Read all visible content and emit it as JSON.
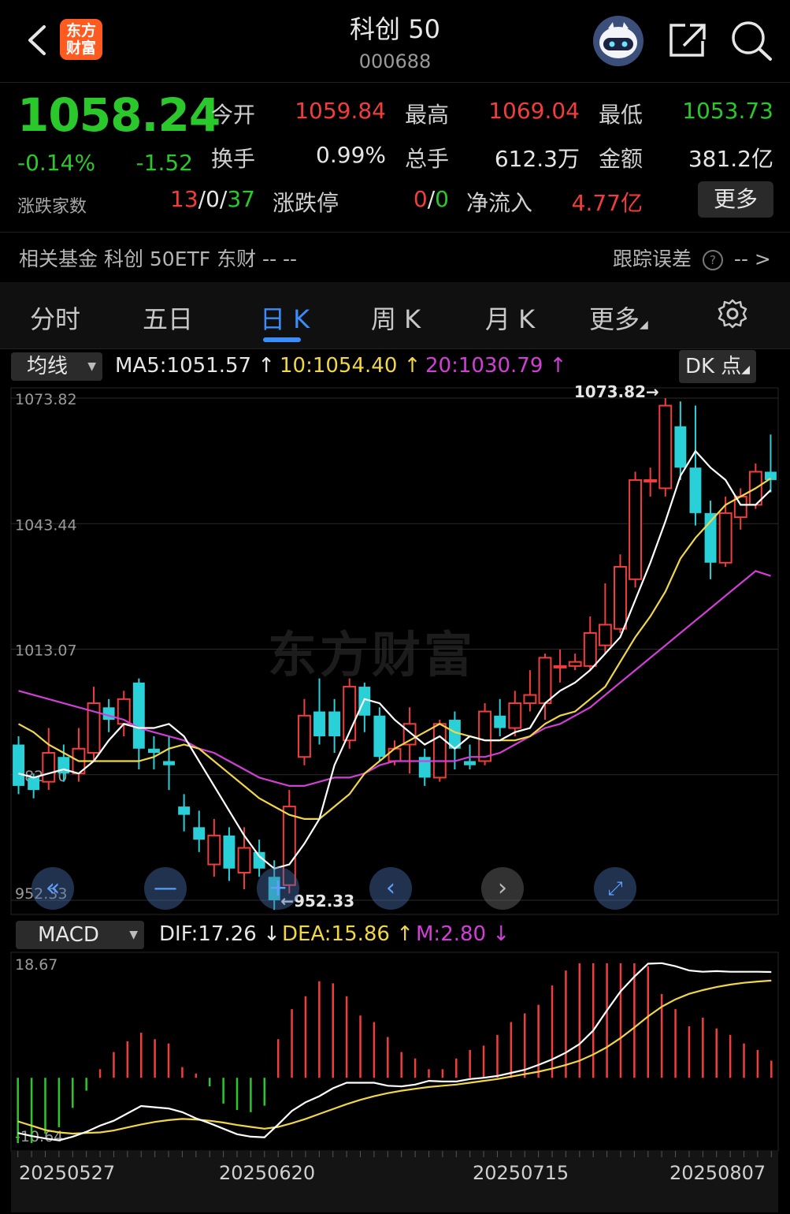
{
  "header": {
    "logo_line1": "东方",
    "logo_line2": "财富",
    "title": "科创 50",
    "code": "000688"
  },
  "quote": {
    "price": "1058.24",
    "change_pct": "-0.14%",
    "change": "-1.52",
    "fields": [
      {
        "label": "今开",
        "value": "1059.84",
        "color": "#f23d3d"
      },
      {
        "label": "最高",
        "value": "1069.04",
        "color": "#f23d3d"
      },
      {
        "label": "最低",
        "value": "1053.73",
        "color": "#2bc82b"
      },
      {
        "label": "换手",
        "value": "0.99%",
        "color": "#e6e6e6"
      },
      {
        "label": "总手",
        "value": "612.3万",
        "color": "#e6e6e6"
      },
      {
        "label": "金额",
        "value": "381.2亿",
        "color": "#e6e6e6"
      }
    ],
    "adv_dec_label": "涨跌家数",
    "adv": "13",
    "flat": "0",
    "dec": "37",
    "limit_label": "涨跌停",
    "limit_up": "0",
    "limit_down": "0",
    "netflow_label": "净流入",
    "netflow": "4.77亿",
    "more_label": "更多"
  },
  "fund_row": {
    "label": "相关基金  科创 50ETF 东财 -- --",
    "tracking_label": "跟踪误差",
    "tracking_value": "-- "
  },
  "tabs": [
    {
      "label": "分时",
      "active": false
    },
    {
      "label": "五日",
      "active": false
    },
    {
      "label": "日 K",
      "active": true
    },
    {
      "label": "周 K",
      "active": false
    },
    {
      "label": "月 K",
      "active": false
    },
    {
      "label": "更多",
      "active": false
    }
  ],
  "ma_row": {
    "select_label": "均线",
    "ma5": "MA5:1051.57 ↑",
    "ma10": "10:1054.40 ↑",
    "ma20": "20:1030.79 ↑",
    "dk_label": "DK 点"
  },
  "watermark": "东方财富",
  "chart_data": [
    {
      "type": "candlestick",
      "y_axis_labels": [
        "1073.82",
        "1043.44",
        "1013.07",
        "982.70",
        "952.33"
      ],
      "ylim": [
        952.33,
        1073.82
      ],
      "high_marker": "1073.82→",
      "low_marker": "←952.33",
      "colors": {
        "up": "#f23d3d",
        "down": "#2ad0d8",
        "ma5": "#ffffff",
        "ma10": "#f0d648",
        "ma20": "#d33ed8"
      },
      "candles": [
        {
          "o": 990,
          "c": 980,
          "h": 992,
          "l": 978
        },
        {
          "o": 982,
          "c": 979,
          "h": 983,
          "l": 977
        },
        {
          "o": 981,
          "c": 988,
          "h": 994,
          "l": 979
        },
        {
          "o": 987,
          "c": 983,
          "h": 990,
          "l": 981
        },
        {
          "o": 983,
          "c": 989,
          "h": 994,
          "l": 981
        },
        {
          "o": 988,
          "c": 1000,
          "h": 1004,
          "l": 986
        },
        {
          "o": 999,
          "c": 996,
          "h": 1001,
          "l": 993
        },
        {
          "o": 995,
          "c": 1001,
          "h": 1003,
          "l": 992
        },
        {
          "o": 1005,
          "c": 989,
          "h": 1006,
          "l": 984
        },
        {
          "o": 989,
          "c": 988,
          "h": 992,
          "l": 984
        },
        {
          "o": 986,
          "c": 985,
          "h": 992,
          "l": 979
        },
        {
          "o": 975,
          "c": 973,
          "h": 978,
          "l": 969
        },
        {
          "o": 970,
          "c": 967,
          "h": 974,
          "l": 964
        },
        {
          "o": 961,
          "c": 968,
          "h": 972,
          "l": 958
        },
        {
          "o": 968,
          "c": 960,
          "h": 970,
          "l": 957
        },
        {
          "o": 959,
          "c": 965,
          "h": 970,
          "l": 955
        },
        {
          "o": 964,
          "c": 960,
          "h": 967,
          "l": 958
        },
        {
          "o": 958,
          "c": 952.33,
          "h": 962,
          "l": 950
        },
        {
          "o": 956,
          "c": 975,
          "h": 979,
          "l": 954
        },
        {
          "o": 987,
          "c": 997,
          "h": 1001,
          "l": 985
        },
        {
          "o": 998,
          "c": 992,
          "h": 1006,
          "l": 990
        },
        {
          "o": 998,
          "c": 992,
          "h": 1001,
          "l": 988
        },
        {
          "o": 991,
          "c": 1004,
          "h": 1006,
          "l": 989
        },
        {
          "o": 1004,
          "c": 997,
          "h": 1005,
          "l": 993
        },
        {
          "o": 997,
          "c": 987,
          "h": 999,
          "l": 986
        },
        {
          "o": 986,
          "c": 989,
          "h": 991,
          "l": 985
        },
        {
          "o": 990,
          "c": 995,
          "h": 999,
          "l": 983
        },
        {
          "o": 987,
          "c": 982,
          "h": 989,
          "l": 980
        },
        {
          "o": 982,
          "c": 995,
          "h": 996,
          "l": 981
        },
        {
          "o": 996,
          "c": 989,
          "h": 998,
          "l": 984
        },
        {
          "o": 986,
          "c": 985,
          "h": 990,
          "l": 984
        },
        {
          "o": 986,
          "c": 998,
          "h": 1000,
          "l": 985
        },
        {
          "o": 997,
          "c": 994,
          "h": 1001,
          "l": 992
        },
        {
          "o": 994,
          "c": 1000,
          "h": 1003,
          "l": 992
        },
        {
          "o": 1000,
          "c": 1002,
          "h": 1008,
          "l": 998
        },
        {
          "o": 1000,
          "c": 1011,
          "h": 1012,
          "l": 996
        },
        {
          "o": 1009,
          "c": 1009,
          "h": 1013,
          "l": 1005
        },
        {
          "o": 1009,
          "c": 1010,
          "h": 1012,
          "l": 1008
        },
        {
          "o": 1009,
          "c": 1017,
          "h": 1021,
          "l": 1008
        },
        {
          "o": 1014,
          "c": 1019,
          "h": 1029,
          "l": 1012
        },
        {
          "o": 1018,
          "c": 1033,
          "h": 1036,
          "l": 1017
        },
        {
          "o": 1030,
          "c": 1054,
          "h": 1056,
          "l": 1028
        },
        {
          "o": 1054,
          "c": 1054,
          "h": 1057,
          "l": 1050
        },
        {
          "o": 1052,
          "c": 1072,
          "h": 1073.82,
          "l": 1050
        },
        {
          "o": 1067,
          "c": 1057,
          "h": 1073,
          "l": 1054
        },
        {
          "o": 1057,
          "c": 1046,
          "h": 1072,
          "l": 1043
        },
        {
          "o": 1046,
          "c": 1034,
          "h": 1049,
          "l": 1030
        },
        {
          "o": 1034,
          "c": 1046,
          "h": 1050,
          "l": 1033
        },
        {
          "o": 1045,
          "c": 1050,
          "h": 1052,
          "l": 1042
        },
        {
          "o": 1048,
          "c": 1056,
          "h": 1058,
          "l": 1047
        },
        {
          "o": 1056,
          "c": 1054,
          "h": 1065,
          "l": 1051
        }
      ],
      "ma5": [
        983,
        982,
        983,
        984,
        983,
        986,
        991,
        995,
        994,
        994,
        995,
        992,
        986,
        980,
        974,
        968,
        963,
        960,
        961,
        966,
        972,
        985,
        993,
        1001,
        1000,
        996,
        993,
        990,
        992,
        989,
        992,
        991,
        991,
        993,
        994,
        1000,
        1003,
        1005,
        1008,
        1012,
        1016,
        1025,
        1034,
        1044,
        1055,
        1061,
        1057,
        1054,
        1048,
        1048,
        1051.57
      ],
      "ma10": [
        995,
        993,
        990,
        988,
        986,
        986,
        986,
        986,
        986,
        987,
        989,
        990,
        989,
        986,
        983,
        980,
        977,
        975,
        973,
        972,
        972,
        975,
        978,
        983,
        986,
        989,
        991,
        993,
        995,
        993,
        992,
        991,
        991,
        991,
        992,
        995,
        997,
        998,
        1001,
        1004,
        1010,
        1016,
        1021,
        1027,
        1035,
        1040,
        1044,
        1048,
        1050,
        1052,
        1054.4
      ],
      "ma20": [
        1003,
        1002,
        1001,
        1000,
        999,
        998,
        997,
        996,
        994,
        993,
        992,
        991,
        989,
        988,
        986,
        984,
        982,
        981,
        980,
        980,
        981,
        982,
        982,
        983,
        985,
        986,
        986,
        986,
        986,
        986,
        987,
        987,
        988,
        990,
        992,
        994,
        995,
        997,
        999,
        1002,
        1005,
        1008,
        1011,
        1014,
        1017,
        1020,
        1023,
        1026,
        1029,
        1032,
        1030.79
      ]
    },
    {
      "type": "bar+line",
      "title": "MACD",
      "dif_label": "DIF:17.26 ↓",
      "dea_label": "DEA:15.86 ↑",
      "m_label": "M:2.80 ↓",
      "y_axis_labels": [
        "18.67",
        "-10.64"
      ],
      "ylim": [
        -10.64,
        18.67
      ],
      "x_labels": [
        "20250527",
        "20250620",
        "20250715",
        "20250807"
      ],
      "colors": {
        "pos": "#f23d3d",
        "neg": "#2bc82b",
        "dif": "#ffffff",
        "dea": "#f0d648"
      },
      "m": [
        -5,
        -4,
        -2.6,
        -2.3,
        -1.4,
        -0.6,
        0.4,
        1.2,
        1.7,
        2.1,
        1.8,
        1.6,
        0.5,
        0.2,
        -0.4,
        -1.2,
        -1.5,
        -1.6,
        -1.3,
        1.8,
        3.2,
        3.8,
        4.5,
        4.4,
        3.8,
        2.9,
        2.6,
        1.9,
        1.2,
        0.9,
        0.4,
        0.4,
        0.9,
        1.3,
        1.5,
        2.0,
        2.6,
        3.0,
        3.4,
        4.3,
        5.0,
        5.6,
        6.3,
        7.2,
        7.8,
        6.9,
        5.2,
        3.9,
        3.2,
        2.4,
        2.8,
        2.3,
        2.0,
        1.6,
        1.3,
        0.8
      ],
      "dif": [
        -9,
        -9.5,
        -9.9,
        -10.2,
        -9.6,
        -8.8,
        -7.8,
        -7,
        -5.8,
        -4.6,
        -4.8,
        -5,
        -5.6,
        -6.6,
        -7.4,
        -8.3,
        -9.2,
        -9.6,
        -9.7,
        -7.6,
        -5.4,
        -4,
        -3,
        -1.7,
        -0.8,
        -0.8,
        -0.8,
        -1.3,
        -1.4,
        -1.1,
        -0.5,
        -0.6,
        -0.6,
        -0.2,
        0,
        0.3,
        0.8,
        1.3,
        2.1,
        3.0,
        4.1,
        5.5,
        7.7,
        11,
        14.1,
        16.5,
        18.6,
        18.7,
        18.2,
        17.5,
        17.3,
        17.4,
        17.3,
        17.3,
        17.3,
        17.26
      ],
      "dea": [
        -7.1,
        -7.8,
        -8.5,
        -8.9,
        -9.1,
        -9.0,
        -8.9,
        -8.6,
        -8.1,
        -7.6,
        -7.2,
        -6.9,
        -6.7,
        -6.8,
        -7.0,
        -7.3,
        -7.7,
        -8.0,
        -8.3,
        -8.0,
        -7.4,
        -6.7,
        -5.9,
        -5.1,
        -4.3,
        -3.6,
        -3.0,
        -2.5,
        -2.1,
        -1.8,
        -1.5,
        -1.3,
        -1.1,
        -0.8,
        -0.5,
        -0.2,
        0.2,
        0.6,
        1.0,
        1.5,
        2.1,
        2.8,
        3.8,
        5.0,
        6.5,
        8.2,
        10.0,
        11.6,
        12.8,
        13.7,
        14.3,
        14.8,
        15.2,
        15.5,
        15.7,
        15.86
      ]
    }
  ]
}
